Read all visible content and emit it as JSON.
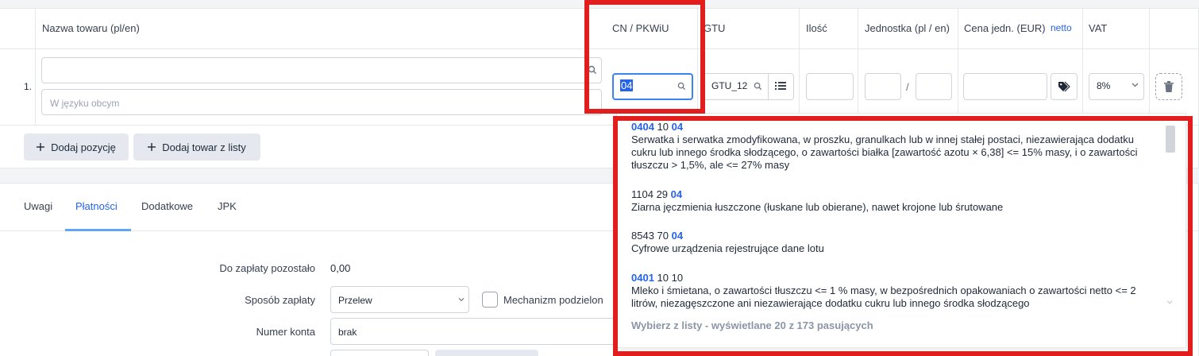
{
  "table": {
    "headers": {
      "name": "Nazwa towaru (pl/en)",
      "cn": "CN / PKWiU",
      "gtu": "GTU",
      "qty": "Ilość",
      "unit": "Jednostka (pl / en)",
      "price": "Cena jedn. (EUR)",
      "price_mode": "netto",
      "vat": "VAT"
    },
    "row": {
      "number": "1.",
      "name_value": "",
      "foreign_placeholder": "W języku obcym",
      "cn_value": "04",
      "gtu_value": "GTU_12",
      "unit_separator": "/",
      "vat_value": "8%"
    },
    "add_item_label": "Dodaj pozycję",
    "add_from_list_label": "Dodaj towar z listy"
  },
  "tabs": [
    {
      "label": "Uwagi"
    },
    {
      "label": "Płatności"
    },
    {
      "label": "Dodatkowe"
    },
    {
      "label": "JPK"
    }
  ],
  "payment": {
    "remaining_label": "Do zapłaty pozostało",
    "remaining_value": "0,00",
    "method_label": "Sposób zapłaty",
    "method_value": "Przelew",
    "split_label": "Mechanizm podzielon",
    "account_label": "Numer konta",
    "account_value": "brak"
  },
  "dropdown": {
    "items": [
      {
        "code_hl1": "0404",
        "code_mid": " 10 ",
        "code_hl2": "04",
        "desc": "Serwatka i serwatka zmodyfikowana, w proszku, granulkach lub w innej stałej postaci, niezawierająca dodatku cukru lub innego środka słodzącego, o zawartości białka [zawartość azotu × 6,38] <= 15% masy, i o zawartości tłuszczu > 1,5%, ale <= 27% masy"
      },
      {
        "code_hl1": "",
        "code_mid": "1104 29 ",
        "code_hl2": "04",
        "desc": "Ziarna jęczmienia łuszczone (łuskane lub obierane), nawet krojone lub śrutowane"
      },
      {
        "code_hl1": "",
        "code_mid": "8543 70 ",
        "code_hl2": "04",
        "desc": "Cyfrowe urządzenia rejestrujące dane lotu"
      },
      {
        "code_hl1": "0401",
        "code_mid": " 10 10",
        "code_hl2": "",
        "desc": "Mleko i śmietana, o zawartości tłuszczu <= 1 % masy, w bezpośrednich opakowaniach o zawartości netto <= 2 litrów, niezagęszczone ani niezawierające dodatku cukru lub innego środka słodzącego"
      }
    ],
    "footer": "Wybierz z listy - wyświetlane 20 z 173 pasujących"
  },
  "colors": {
    "accent": "#2563eb",
    "highlight_box": "#e11d1d",
    "tab_active_underline": "#60a5fa"
  },
  "icons": [
    "search-icon",
    "list-icon",
    "tag-icon",
    "chevron-down-icon",
    "trash-icon",
    "plus-icon"
  ]
}
